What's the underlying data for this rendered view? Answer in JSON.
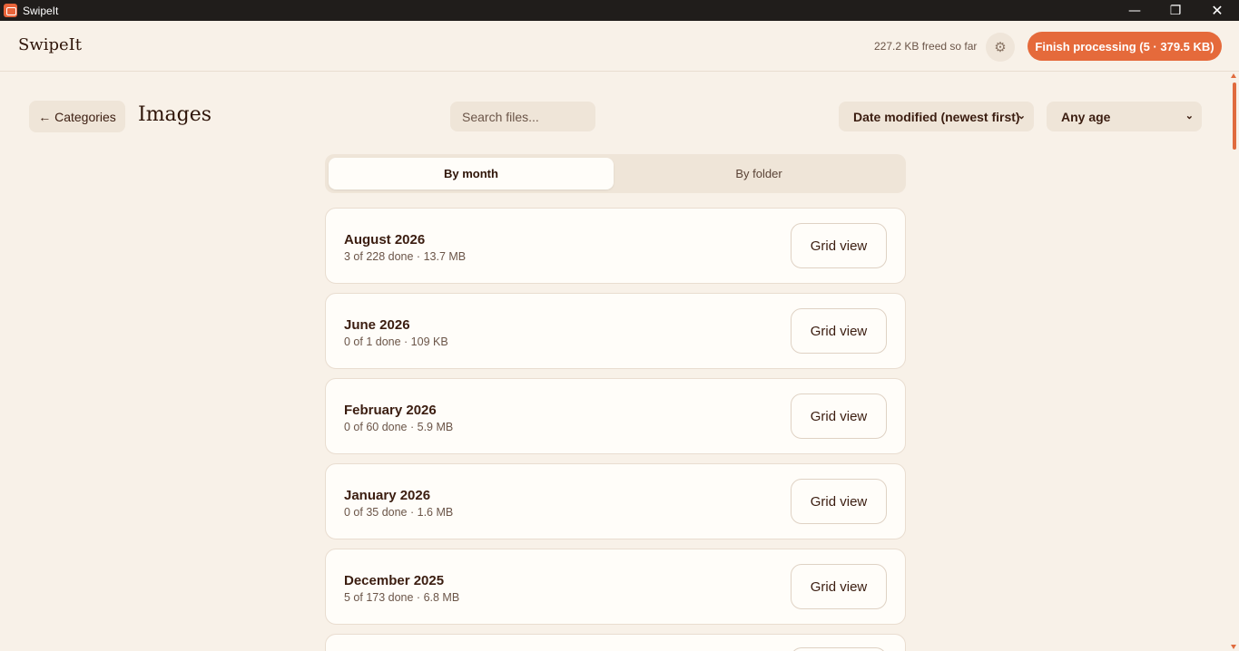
{
  "window": {
    "title": "SwipeIt",
    "minimize_glyph": "—",
    "maximize_glyph": "❐",
    "close_glyph": "✕"
  },
  "header": {
    "brand": "SwipeIt",
    "freed_text": "227.2 KB freed so far",
    "settings_icon": "gear-icon",
    "settings_glyph": "⚙",
    "finish_label": "Finish processing (5 · 379.5 KB)"
  },
  "toolbar": {
    "back_label": "← Categories",
    "page_title": "Images",
    "search_placeholder": "Search files...",
    "sort_value": "Date modified (newest first)",
    "age_value": "Any age",
    "chevron_glyph": "⌄"
  },
  "view_toggle": {
    "by_month": "By month",
    "by_folder": "By folder",
    "active": "By month"
  },
  "months": [
    {
      "title": "August 2026",
      "subtitle": "3 of 228 done · 13.7 MB",
      "button": "Grid view"
    },
    {
      "title": "June 2026",
      "subtitle": "0 of 1 done · 109 KB",
      "button": "Grid view"
    },
    {
      "title": "February 2026",
      "subtitle": "0 of 60 done · 5.9 MB",
      "button": "Grid view"
    },
    {
      "title": "January 2026",
      "subtitle": "0 of 35 done · 1.6 MB",
      "button": "Grid view"
    },
    {
      "title": "December 2025",
      "subtitle": "5 of 173 done · 6.8 MB",
      "button": "Grid view"
    }
  ],
  "colors": {
    "accent": "#e56a3b",
    "background": "#f8f1e8",
    "card": "#fffdf9",
    "text": "#3b1d10"
  }
}
